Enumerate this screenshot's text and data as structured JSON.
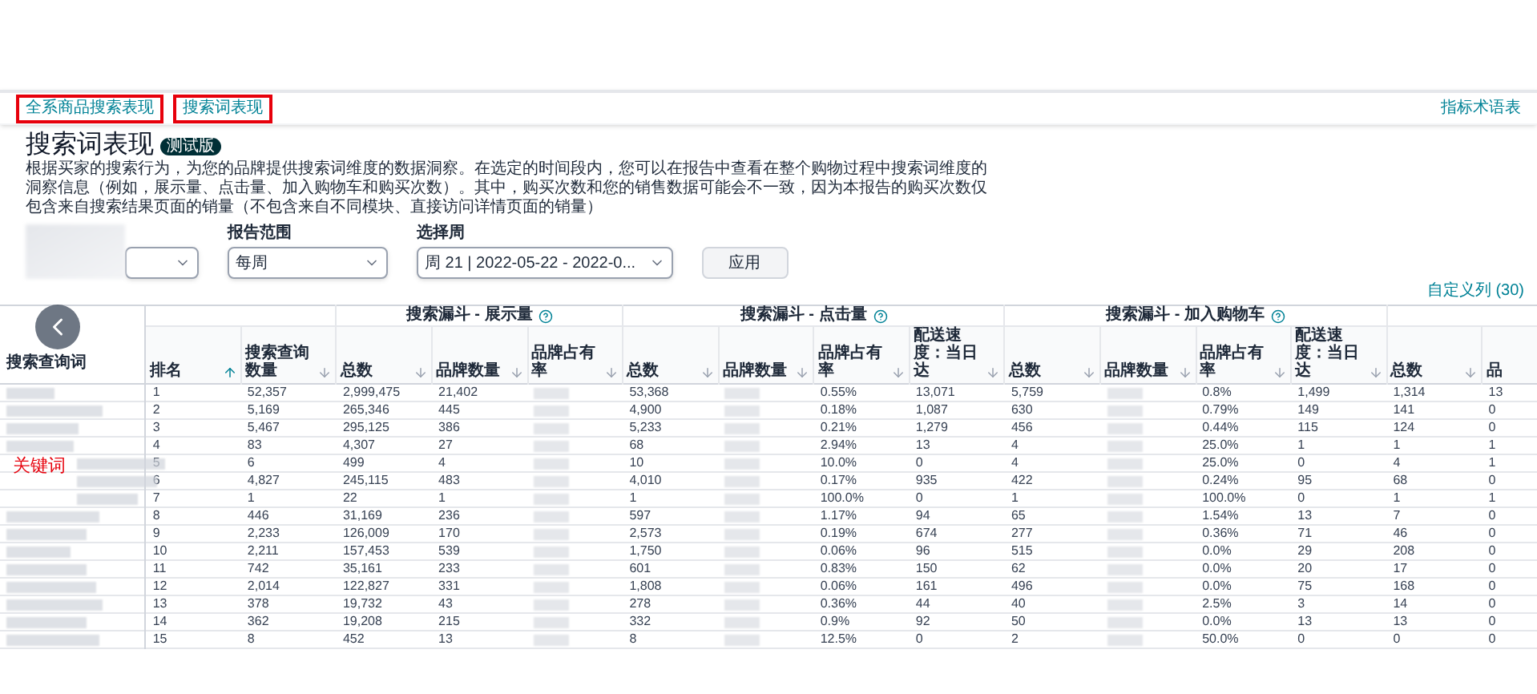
{
  "nav": {
    "tabs": [
      {
        "label": "全系商品搜索表现",
        "highlighted": true
      },
      {
        "label": "搜索词表现",
        "highlighted": true
      }
    ],
    "glossary_link": "指标术语表"
  },
  "title": "搜索词表现",
  "badge": "测试版",
  "description": "根据买家的搜索行为，为您的品牌提供搜索词维度的数据洞察。在选定的时间段内，您可以在报告中查看在整个购物过程中搜索词维度的洞察信息（例如，展示量、点击量、加入购物车和购买次数）。其中，购买次数和您的销售数据可能会不一致，因为本报告的购买次数仅包含来自搜索结果页面的销量（不包含来自不同模块、直接访问详情页面的销量）",
  "filters": [
    {
      "kind": "redacted"
    },
    {
      "kind": "select",
      "label": "报告范围",
      "value": "每周"
    },
    {
      "kind": "select",
      "label": "选择周",
      "value": "周 21 | 2022-05-22 - 2022-0..."
    }
  ],
  "apply_button": "应用",
  "customize_link": "自定义列 (30)",
  "table": {
    "keyword_header": "搜索查询词",
    "column_groups": [
      {
        "columns": [
          {
            "label": "排名",
            "kind": "value",
            "sorted": true
          },
          {
            "label": "搜索查询数量",
            "kind": "value",
            "sorted": false
          }
        ]
      },
      {
        "title": "搜索漏斗 - 展示量",
        "columns": [
          {
            "label": "总数",
            "kind": "value",
            "sorted": false
          },
          {
            "label": "品牌数量",
            "kind": "value",
            "sorted": false
          },
          {
            "label": "品牌占有率",
            "kind": "redacted",
            "sorted": false
          }
        ]
      },
      {
        "title": "搜索漏斗 - 点击量",
        "columns": [
          {
            "label": "总数",
            "kind": "value",
            "sorted": false
          },
          {
            "label": "品牌数量",
            "kind": "redacted",
            "sorted": false
          },
          {
            "label": "品牌占有率",
            "kind": "value",
            "sorted": false
          },
          {
            "label": "配送速度：当日达",
            "kind": "value",
            "sorted": false
          }
        ]
      },
      {
        "title": "搜索漏斗 - 加入购物车",
        "columns": [
          {
            "label": "总数",
            "kind": "value",
            "sorted": false
          },
          {
            "label": "品牌数量",
            "kind": "redacted",
            "sorted": false
          },
          {
            "label": "品牌占有率",
            "kind": "value",
            "sorted": false
          },
          {
            "label": "配送速度：当日达",
            "kind": "value",
            "sorted": false
          }
        ]
      },
      {
        "columns": [
          {
            "label": "总数",
            "kind": "value",
            "sorted": false
          },
          {
            "label": "品",
            "kind": "value"
          }
        ]
      }
    ],
    "rows": [
      {
        "values": [
          "1",
          "52,357",
          "2,999,475",
          "21,402",
          "53,368",
          "0.55%",
          "13,071",
          "5,759",
          "0.8%",
          "1,499",
          "1,314",
          "13"
        ]
      },
      {
        "values": [
          "2",
          "5,169",
          "265,346",
          "445",
          "4,900",
          "0.18%",
          "1,087",
          "630",
          "0.79%",
          "149",
          "141",
          "0"
        ]
      },
      {
        "values": [
          "3",
          "5,467",
          "295,125",
          "386",
          "5,233",
          "0.21%",
          "1,279",
          "456",
          "0.44%",
          "115",
          "124",
          "0"
        ]
      },
      {
        "values": [
          "4",
          "83",
          "4,307",
          "27",
          "68",
          "2.94%",
          "13",
          "4",
          "25.0%",
          "1",
          "1",
          "1"
        ]
      },
      {
        "values": [
          "5",
          "6",
          "499",
          "4",
          "10",
          "10.0%",
          "0",
          "4",
          "25.0%",
          "0",
          "4",
          "1"
        ]
      },
      {
        "values": [
          "6",
          "4,827",
          "245,115",
          "483",
          "4,010",
          "0.17%",
          "935",
          "422",
          "0.24%",
          "95",
          "68",
          "0"
        ]
      },
      {
        "values": [
          "7",
          "1",
          "22",
          "1",
          "1",
          "100.0%",
          "0",
          "1",
          "100.0%",
          "0",
          "1",
          "1"
        ]
      },
      {
        "values": [
          "8",
          "446",
          "31,169",
          "236",
          "597",
          "1.17%",
          "94",
          "65",
          "1.54%",
          "13",
          "7",
          "0"
        ]
      },
      {
        "values": [
          "9",
          "2,233",
          "126,009",
          "170",
          "2,573",
          "0.19%",
          "674",
          "277",
          "0.36%",
          "71",
          "46",
          "0"
        ]
      },
      {
        "values": [
          "10",
          "2,211",
          "157,453",
          "539",
          "1,750",
          "0.06%",
          "96",
          "515",
          "0.0%",
          "29",
          "208",
          "0"
        ]
      },
      {
        "values": [
          "11",
          "742",
          "35,161",
          "233",
          "601",
          "0.83%",
          "150",
          "62",
          "0.0%",
          "20",
          "17",
          "0"
        ]
      },
      {
        "values": [
          "12",
          "2,014",
          "122,827",
          "331",
          "1,808",
          "0.06%",
          "161",
          "496",
          "0.0%",
          "75",
          "168",
          "0"
        ]
      },
      {
        "values": [
          "13",
          "378",
          "19,732",
          "43",
          "278",
          "0.36%",
          "44",
          "40",
          "2.5%",
          "3",
          "14",
          "0"
        ]
      },
      {
        "values": [
          "14",
          "362",
          "19,208",
          "215",
          "332",
          "0.9%",
          "92",
          "50",
          "0.0%",
          "13",
          "13",
          "0"
        ]
      },
      {
        "values": [
          "15",
          "8",
          "452",
          "13",
          "8",
          "12.5%",
          "0",
          "2",
          "50.0%",
          "0",
          "0",
          "0"
        ]
      }
    ]
  },
  "annotation": "关键词"
}
